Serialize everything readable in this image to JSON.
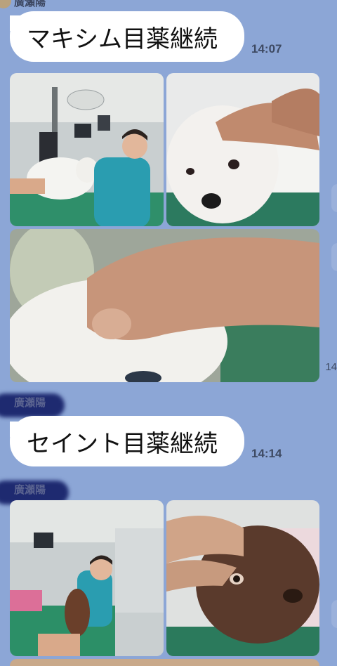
{
  "messages": [
    {
      "sender": "廣瀬陽",
      "text": "マキシム目薬継続",
      "time": "14:07"
    },
    {
      "sender": "廣瀬陽",
      "text": "セイント目薬継続",
      "time": "14:14"
    }
  ],
  "partial_time": "14",
  "photos": {
    "group1": [
      "vet-exam-white-dog",
      "white-dog-eye-closeup",
      "white-dog-eyelid-closeup"
    ],
    "group2": [
      "vet-exam-brown-dog",
      "brown-dog-eye-closeup"
    ]
  },
  "colors": {
    "background": "#8ca6d6",
    "bubble": "#ffffff",
    "time_text": "#3e4a63"
  }
}
